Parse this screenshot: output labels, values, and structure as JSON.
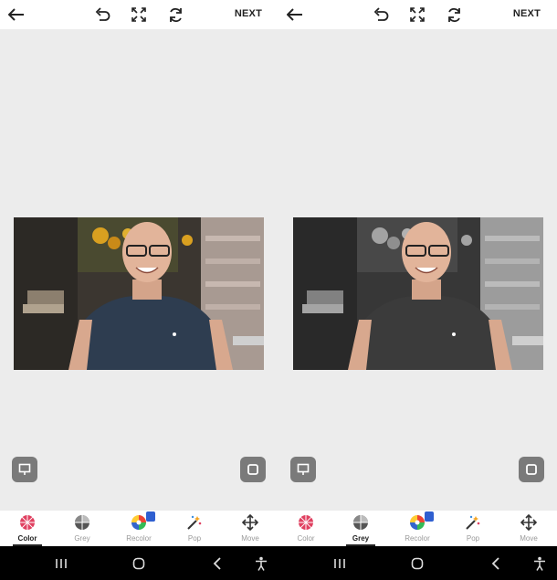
{
  "panes": [
    {
      "id": "left",
      "topbar": {
        "next_label": "NEXT"
      },
      "active_tool": "Color"
    },
    {
      "id": "right",
      "topbar": {
        "next_label": "NEXT"
      },
      "active_tool": "Grey"
    }
  ],
  "tools": [
    {
      "label": "Color",
      "icon": "color-wheel-icon"
    },
    {
      "label": "Grey",
      "icon": "grey-wheel-icon"
    },
    {
      "label": "Recolor",
      "icon": "recolor-wheel-icon"
    },
    {
      "label": "Pop",
      "icon": "magic-wand-icon"
    },
    {
      "label": "Move",
      "icon": "move-arrows-icon"
    }
  ],
  "colors": {
    "accent_badge": "#2f5fd0",
    "corner_button": "#7a7a7a",
    "canvas_bg": "#ececec"
  }
}
